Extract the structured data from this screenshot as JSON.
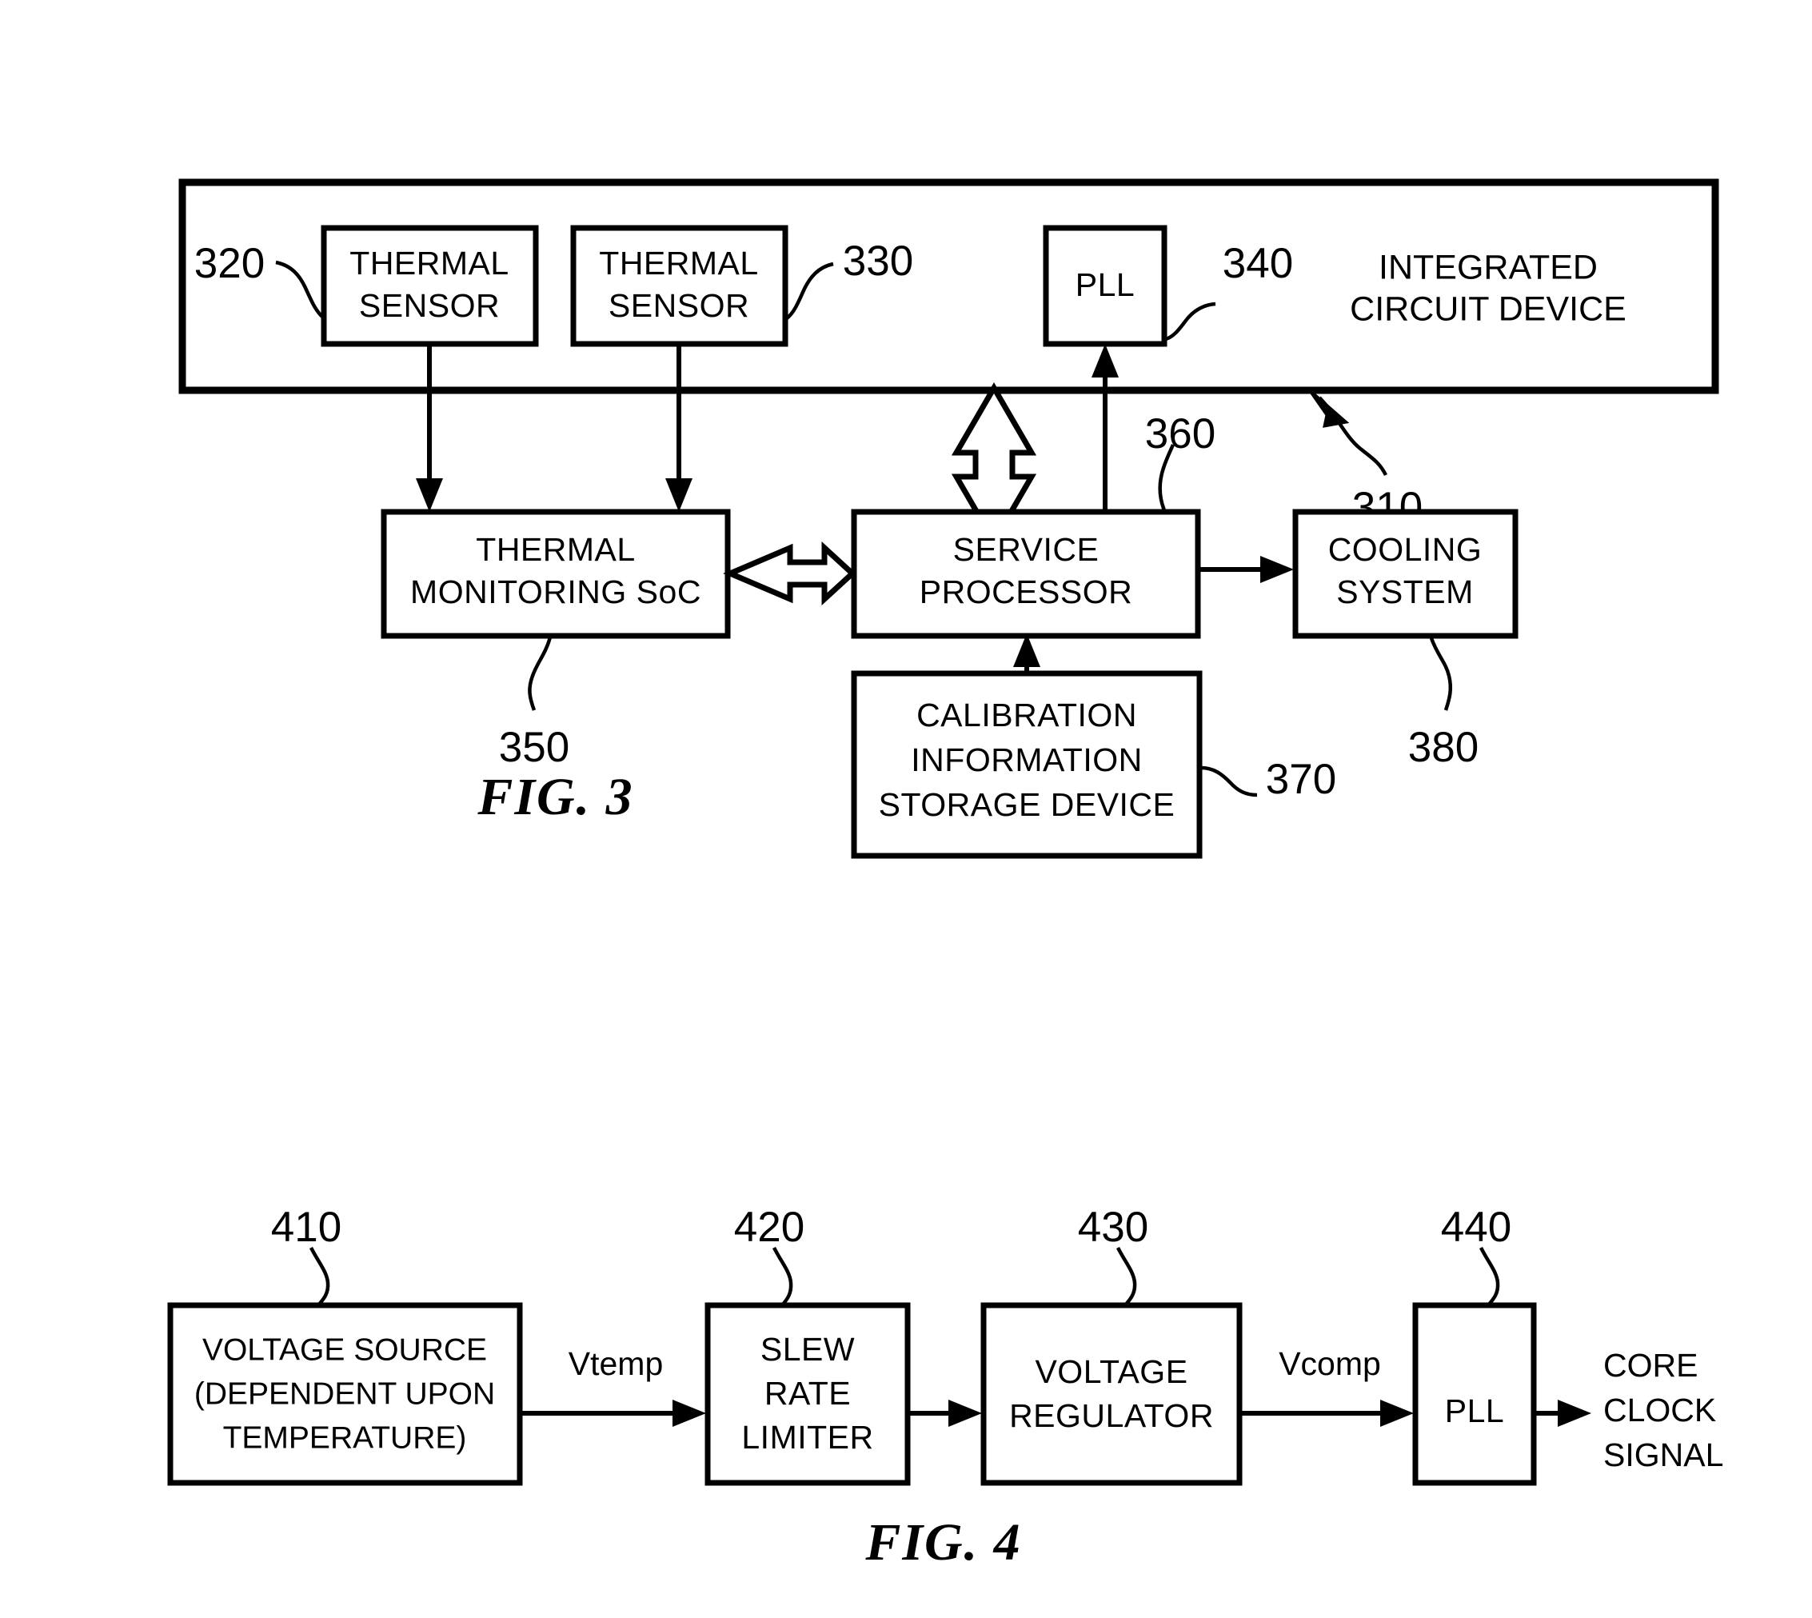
{
  "figures": [
    {
      "id": "fig3",
      "caption": "FIG. 3",
      "container": {
        "label_line1": "INTEGRATED",
        "label_line2": "CIRCUIT DEVICE",
        "ref": "310"
      },
      "blocks": {
        "thermal_sensor_1": {
          "line1": "THERMAL",
          "line2": "SENSOR",
          "ref": "320"
        },
        "thermal_sensor_2": {
          "line1": "THERMAL",
          "line2": "SENSOR",
          "ref": "330"
        },
        "pll": {
          "line1": "PLL",
          "ref": "340"
        },
        "thermal_monitoring_soc": {
          "line1": "THERMAL",
          "line2": "MONITORING SoC",
          "ref": "350"
        },
        "service_processor": {
          "line1": "SERVICE",
          "line2": "PROCESSOR",
          "ref": "360"
        },
        "calibration_storage": {
          "line1": "CALIBRATION",
          "line2": "INFORMATION",
          "line3": "STORAGE DEVICE",
          "ref": "370"
        },
        "cooling_system": {
          "line1": "COOLING",
          "line2": "SYSTEM",
          "ref": "380"
        }
      }
    },
    {
      "id": "fig4",
      "caption": "FIG. 4",
      "blocks": {
        "voltage_source": {
          "line1": "VOLTAGE SOURCE",
          "line2": "(DEPENDENT UPON",
          "line3": "TEMPERATURE)",
          "ref": "410"
        },
        "slew_rate_limiter": {
          "line1": "SLEW",
          "line2": "RATE",
          "line3": "LIMITER",
          "ref": "420"
        },
        "voltage_regulator": {
          "line1": "VOLTAGE",
          "line2": "REGULATOR",
          "ref": "430"
        },
        "pll": {
          "line1": "PLL",
          "ref": "440"
        }
      },
      "signals": {
        "vtemp": "Vtemp",
        "vcomp": "Vcomp",
        "core_clock_line1": "CORE",
        "core_clock_line2": "CLOCK",
        "core_clock_line3": "SIGNAL"
      }
    }
  ],
  "colors": {
    "ink": "#000000",
    "paper": "#ffffff"
  }
}
